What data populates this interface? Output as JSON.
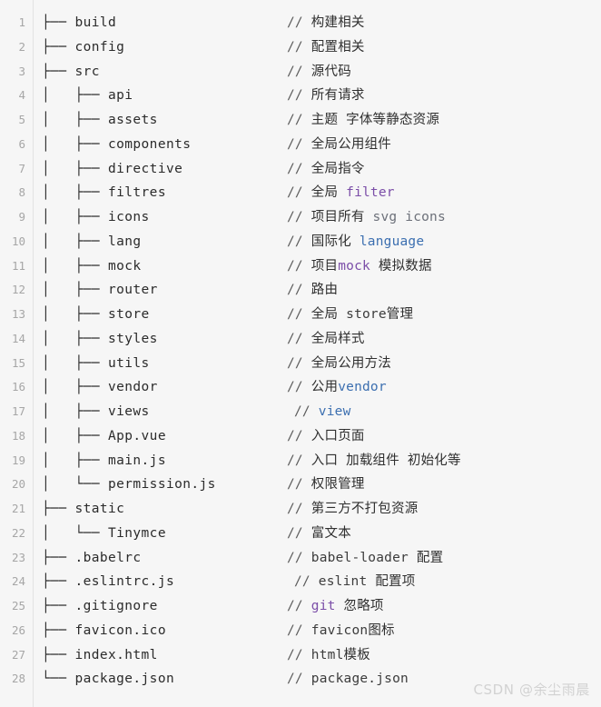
{
  "code_block": {
    "language": "plaintext",
    "background_color": "#f6f6f6",
    "gutter_color": "#a6a6a6",
    "line_count": 28,
    "rows": [
      {
        "n": "1",
        "tree": "├── build",
        "indent": false,
        "comment_prefix": "// ",
        "comment": "构建相关",
        "comment_indent": false
      },
      {
        "n": "2",
        "tree": "├── config",
        "indent": false,
        "comment_prefix": "// ",
        "comment": "配置相关",
        "comment_indent": false
      },
      {
        "n": "3",
        "tree": "├── src",
        "indent": false,
        "comment_prefix": "// ",
        "comment": "源代码",
        "comment_indent": false
      },
      {
        "n": "4",
        "tree": "│   ├── api",
        "indent": false,
        "comment_prefix": "// ",
        "comment": "所有请求",
        "comment_indent": false
      },
      {
        "n": "5",
        "tree": "│   ├── assets",
        "indent": false,
        "comment_prefix": "// ",
        "comment": "主题 字体等静态资源",
        "comment_indent": false
      },
      {
        "n": "6",
        "tree": "│   ├── components",
        "indent": false,
        "comment_prefix": "// ",
        "comment": "全局公用组件",
        "comment_indent": false
      },
      {
        "n": "7",
        "tree": "│   ├── directive",
        "indent": false,
        "comment_prefix": "// ",
        "comment": "全局指令",
        "comment_indent": false
      },
      {
        "n": "8",
        "tree": "│   ├── filtres",
        "indent": false,
        "comment_prefix": "// ",
        "comment": "全局 filter",
        "comment_indent": false
      },
      {
        "n": "9",
        "tree": "│   ├── icons",
        "indent": false,
        "comment_prefix": "// ",
        "comment": "项目所有 svg icons",
        "comment_indent": false
      },
      {
        "n": "10",
        "tree": "│   ├── lang",
        "indent": false,
        "comment_prefix": "// ",
        "comment": "国际化 language",
        "comment_indent": false
      },
      {
        "n": "11",
        "tree": "│   ├── mock",
        "indent": false,
        "comment_prefix": "// ",
        "comment": "项目mock 模拟数据",
        "comment_indent": false
      },
      {
        "n": "12",
        "tree": "│   ├── router",
        "indent": false,
        "comment_prefix": "// ",
        "comment": "路由",
        "comment_indent": false
      },
      {
        "n": "13",
        "tree": "│   ├── store",
        "indent": false,
        "comment_prefix": "// ",
        "comment": "全局 store管理",
        "comment_indent": false
      },
      {
        "n": "14",
        "tree": "│   ├── styles",
        "indent": false,
        "comment_prefix": "// ",
        "comment": "全局样式",
        "comment_indent": false
      },
      {
        "n": "15",
        "tree": "│   ├── utils",
        "indent": false,
        "comment_prefix": "// ",
        "comment": "全局公用方法",
        "comment_indent": false
      },
      {
        "n": "16",
        "tree": "│   ├── vendor",
        "indent": false,
        "comment_prefix": "// ",
        "comment": "公用vendor",
        "comment_indent": false
      },
      {
        "n": "17",
        "tree": "│   ├── views",
        "indent": false,
        "comment_prefix": "// ",
        "comment": "view",
        "comment_indent": true
      },
      {
        "n": "18",
        "tree": "│   ├── App.vue",
        "indent": false,
        "comment_prefix": "// ",
        "comment": "入口页面",
        "comment_indent": false
      },
      {
        "n": "19",
        "tree": "│   ├── main.js",
        "indent": false,
        "comment_prefix": "// ",
        "comment": "入口 加载组件 初始化等",
        "comment_indent": false
      },
      {
        "n": "20",
        "tree": "│   └── permission.js",
        "indent": false,
        "comment_prefix": "// ",
        "comment": "权限管理",
        "comment_indent": false
      },
      {
        "n": "21",
        "tree": "├── static",
        "indent": false,
        "comment_prefix": "// ",
        "comment": "第三方不打包资源",
        "comment_indent": false
      },
      {
        "n": "22",
        "tree": "│   └── Tinymce",
        "indent": false,
        "comment_prefix": "// ",
        "comment": "富文本",
        "comment_indent": false
      },
      {
        "n": "23",
        "tree": "├── .babelrc",
        "indent": false,
        "comment_prefix": "// ",
        "comment": "babel-loader 配置",
        "comment_indent": false
      },
      {
        "n": "24",
        "tree": "├── .eslintrc.js",
        "indent": false,
        "comment_prefix": "// ",
        "comment": "eslint 配置项",
        "comment_indent": true
      },
      {
        "n": "25",
        "tree": "├── .gitignore",
        "indent": false,
        "comment_prefix": "// ",
        "comment": "git 忽略项",
        "comment_indent": false
      },
      {
        "n": "26",
        "tree": "├── favicon.ico",
        "indent": false,
        "comment_prefix": "// ",
        "comment": "favicon图标",
        "comment_indent": false
      },
      {
        "n": "27",
        "tree": "├── index.html",
        "indent": false,
        "comment_prefix": "// ",
        "comment": "html模板",
        "comment_indent": false
      },
      {
        "n": "28",
        "tree": "└── package.json",
        "indent": false,
        "comment_prefix": "// ",
        "comment": "package.json",
        "comment_indent": false
      }
    ]
  },
  "watermark": {
    "text": "CSDN @余尘雨晨",
    "color": "#d2d2d2"
  }
}
